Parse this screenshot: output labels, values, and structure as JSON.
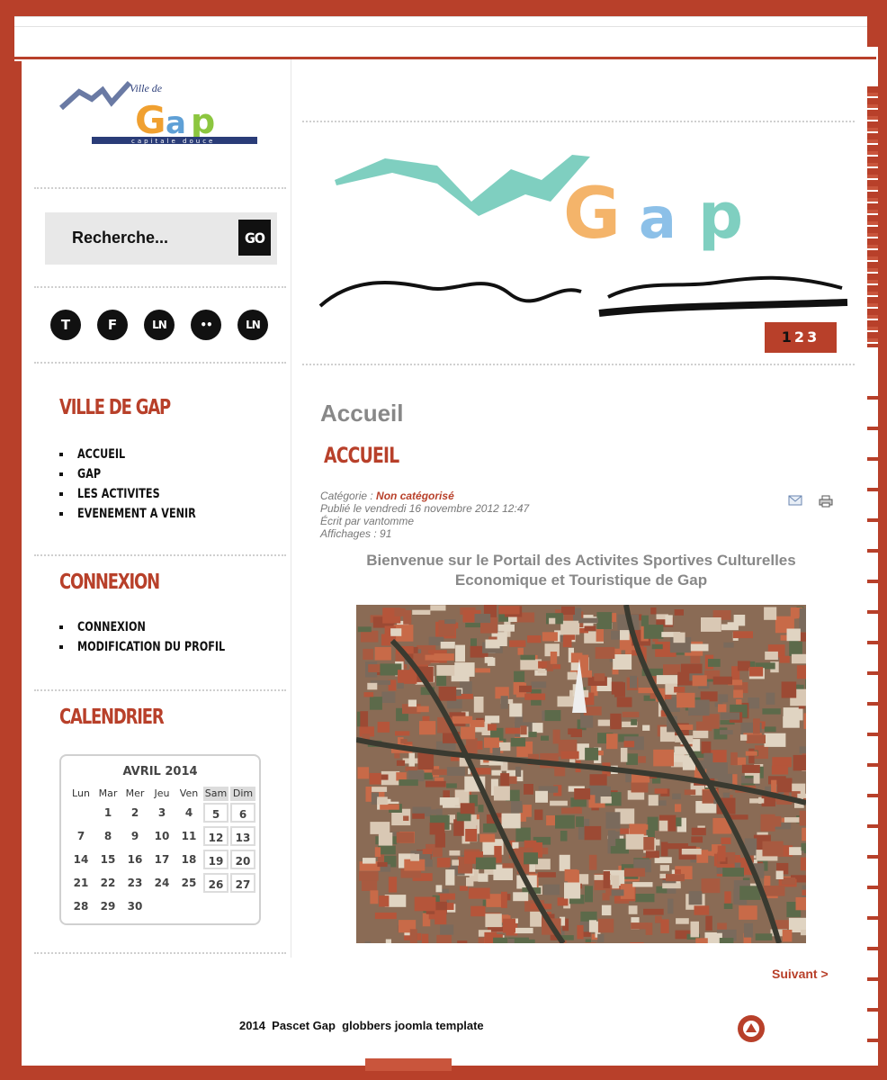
{
  "search": {
    "placeholder": "Recherche...",
    "go_label": "GO"
  },
  "social": [
    {
      "icon": "twitter-icon",
      "label": "T"
    },
    {
      "icon": "facebook-icon",
      "label": "F"
    },
    {
      "icon": "linkedin-icon",
      "label": "LN"
    },
    {
      "icon": "flickr-icon",
      "label": "••"
    },
    {
      "icon": "linkedin-icon",
      "label": "LN"
    }
  ],
  "sidebar": {
    "ville": {
      "title": "Ville de Gap",
      "items": [
        "ACCUEIL",
        "GAP",
        "LES ACTIVITES",
        "EVENEMENT A VENIR"
      ]
    },
    "connexion": {
      "title": "Connexion",
      "items": [
        "CONNEXION",
        "MODIFICATION DU PROFIL"
      ]
    },
    "calendrier": {
      "title": "Calendrier"
    }
  },
  "calendar": {
    "month": "AVRIL 2014",
    "days": [
      "Lun",
      "Mar",
      "Mer",
      "Jeu",
      "Ven",
      "Sam",
      "Dim"
    ],
    "weeks": [
      [
        "",
        "1",
        "2",
        "3",
        "4",
        "5",
        "6"
      ],
      [
        "7",
        "8",
        "9",
        "10",
        "11",
        "12",
        "13"
      ],
      [
        "14",
        "15",
        "16",
        "17",
        "18",
        "19",
        "20"
      ],
      [
        "21",
        "22",
        "23",
        "24",
        "25",
        "26",
        "27"
      ],
      [
        "28",
        "29",
        "30",
        "",
        "",
        "",
        ""
      ]
    ]
  },
  "slider": {
    "pages": [
      "1",
      "2",
      "3"
    ],
    "active": 1
  },
  "article": {
    "page_heading": "Accueil",
    "title": "ACCUEIL",
    "category_label": "Catégorie : ",
    "category": "Non catégorisé",
    "published": "Publié le vendredi 16 novembre 2012 12:47",
    "author": "Écrit par vantomme",
    "hits": "Affichages : 91",
    "intro_line1": "Bienvenue sur le Portail des Activites Sportives Culturelles",
    "intro_line2": "Economique et Touristique de Gap",
    "next_label": "Suivant >"
  },
  "footer": {
    "text": "2014  Pascet Gap  globbers joomla template"
  },
  "colors": {
    "accent": "#b8402a",
    "text_grey": "#888888"
  }
}
